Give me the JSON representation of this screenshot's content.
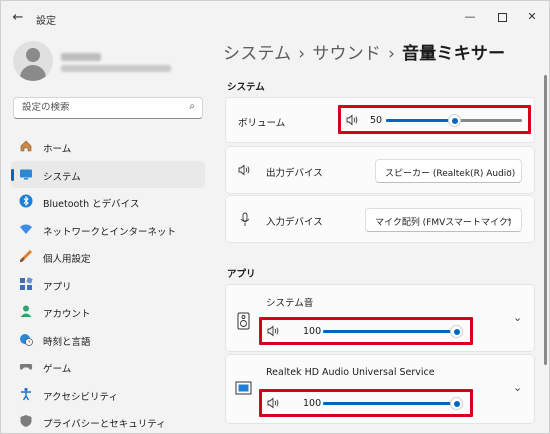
{
  "window": {
    "title": "設定"
  },
  "profile": {
    "name": "",
    "email": ""
  },
  "search": {
    "placeholder": "設定の検索"
  },
  "nav": {
    "items": [
      {
        "label": "ホーム",
        "icon": "home-icon"
      },
      {
        "label": "システム",
        "icon": "system-icon",
        "active": true
      },
      {
        "label": "Bluetooth とデバイス",
        "icon": "bluetooth-icon"
      },
      {
        "label": "ネットワークとインターネット",
        "icon": "wifi-icon"
      },
      {
        "label": "個人用設定",
        "icon": "brush-icon"
      },
      {
        "label": "アプリ",
        "icon": "apps-icon"
      },
      {
        "label": "アカウント",
        "icon": "account-icon"
      },
      {
        "label": "時刻と言語",
        "icon": "globe-clock-icon"
      },
      {
        "label": "ゲーム",
        "icon": "gamepad-icon"
      },
      {
        "label": "アクセシビリティ",
        "icon": "accessibility-icon"
      },
      {
        "label": "プライバシーとセキュリティ",
        "icon": "shield-icon"
      }
    ]
  },
  "breadcrumb": {
    "part1": "システム",
    "part2": "サウンド",
    "current": "音量ミキサー",
    "separator": "›"
  },
  "system_section": {
    "title": "システム",
    "volume": {
      "label": "ボリューム",
      "value": "50",
      "level": 0.5
    },
    "output": {
      "label": "出力デバイス",
      "selected": "スピーカー (Realtek(R) Audio)"
    },
    "input": {
      "label": "入力デバイス",
      "selected": "マイク配列 (FMVスマートマイク)"
    }
  },
  "apps_section": {
    "title": "アプリ",
    "apps": [
      {
        "name": "システム音",
        "value": "100",
        "level": 1.0
      },
      {
        "name": "Realtek HD Audio Universal Service",
        "value": "100",
        "level": 1.0
      }
    ]
  },
  "colors": {
    "accent": "#0067c0",
    "highlight": "#d6001c"
  }
}
